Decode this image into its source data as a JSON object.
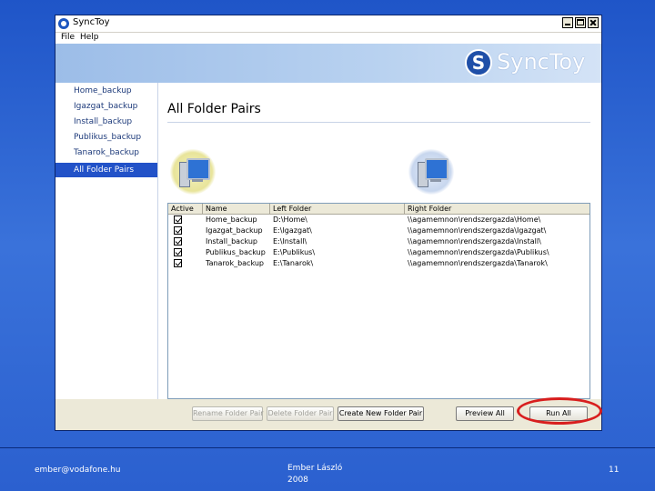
{
  "window": {
    "title": "SyncToy",
    "menu": [
      "File",
      "Help"
    ],
    "brand": "SyncToy"
  },
  "sidebar": {
    "items": [
      {
        "label": "Home_backup"
      },
      {
        "label": "Igazgat_backup"
      },
      {
        "label": "Install_backup"
      },
      {
        "label": "Publikus_backup"
      },
      {
        "label": "Tanarok_backup"
      },
      {
        "label": "All Folder Pairs",
        "active": true
      }
    ]
  },
  "main": {
    "title": "All Folder Pairs",
    "columns": [
      "Active",
      "Name",
      "Left Folder",
      "Right Folder"
    ],
    "rows": [
      {
        "active": true,
        "name": "Home_backup",
        "left": "D:\\Home\\",
        "right": "\\\\agamemnon\\rendszergazda\\Home\\"
      },
      {
        "active": true,
        "name": "Igazgat_backup",
        "left": "E:\\Igazgat\\",
        "right": "\\\\agamemnon\\rendszergazda\\Igazgat\\"
      },
      {
        "active": true,
        "name": "Install_backup",
        "left": "E:\\Install\\",
        "right": "\\\\agamemnon\\rendszergazda\\Install\\"
      },
      {
        "active": true,
        "name": "Publikus_backup",
        "left": "E:\\Publikus\\",
        "right": "\\\\agamemnon\\rendszergazda\\Publikus\\"
      },
      {
        "active": true,
        "name": "Tanarok_backup",
        "left": "E:\\Tanarok\\",
        "right": "\\\\agamemnon\\rendszergazda\\Tanarok\\"
      }
    ]
  },
  "buttons": {
    "rename": "Rename Folder Pair",
    "delete": "Delete Folder Pair",
    "create": "Create New Folder Pair",
    "preview": "Preview All",
    "run": "Run All"
  },
  "footer": {
    "email": "ember@vodafone.hu",
    "author": "Ember László",
    "year": "2008",
    "page": "11"
  },
  "colors": {
    "slide_bg": "#2f67d2",
    "selection": "#2252c8",
    "highlight_ring": "#d81e1e"
  }
}
